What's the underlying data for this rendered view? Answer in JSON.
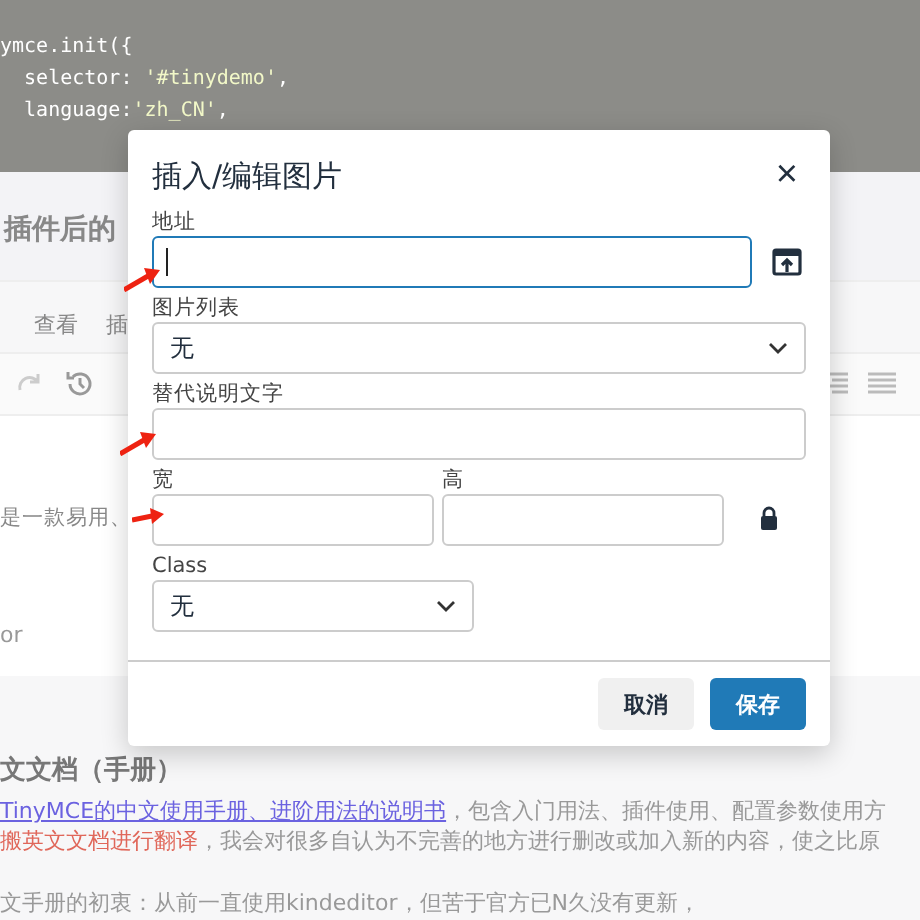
{
  "background": {
    "code_lines": [
      {
        "plain": "ymce.init({"
      },
      {
        "plain": "  selector: ",
        "str": "'#tinydemo'",
        "end": ","
      },
      {
        "plain": "  language:",
        "str": "'zh_CN'",
        "end": ","
      }
    ],
    "heading": "插件后的",
    "menu": [
      "查看",
      "插"
    ],
    "intro": "是一款易用、",
    "field_text": "or",
    "section_title": "文文档（手册）",
    "link": "TinyMCE的中文使用手册、进阶用法的说明书",
    "link_suffix": "，包含入门用法、插件使用、配置参数使用方",
    "red_text": "搬英文文档进行翻译",
    "red_suffix": "，我会对很多自认为不完善的地方进行删改或加入新的内容，使之比原",
    "last_line": "文手册的初衷：从前一直使用kindeditor，但苦于官方已N久没有更新，"
  },
  "dialog": {
    "title": "插入/编辑图片",
    "close": "×",
    "fields": [
      {
        "kind": "url",
        "label": "地址",
        "focused": true
      },
      {
        "kind": "select",
        "label": "图片列表",
        "value": "无",
        "narrow": false
      },
      {
        "kind": "text",
        "label": "替代说明文字"
      },
      {
        "kind": "size",
        "label": "宽",
        "label_2": "高"
      },
      {
        "kind": "select",
        "label": "Class",
        "value": "无",
        "narrow": true
      }
    ],
    "buttons": [
      {
        "label": "取消",
        "primary": false
      },
      {
        "label": "保存",
        "primary": true
      }
    ]
  }
}
